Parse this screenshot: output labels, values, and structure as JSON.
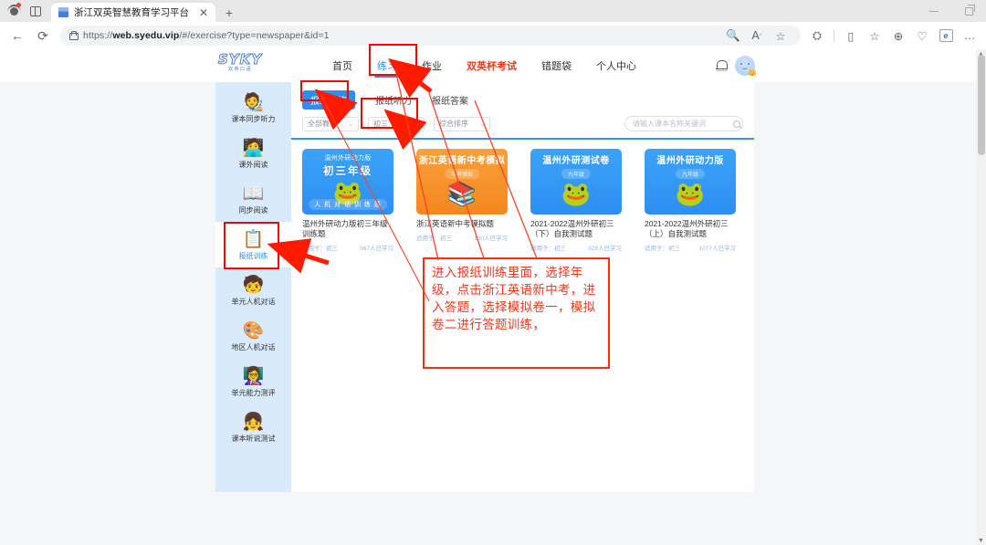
{
  "browser": {
    "tab_title": "浙江双英智慧教育学习平台",
    "tab_close": "✕",
    "new_tab": "+",
    "back": "←",
    "reload": "⟳",
    "url_prefix": "https://",
    "url_domain": "web.syedu.vip",
    "url_path": "/#/exercise?type=newspaper&id=1",
    "tool_icons": [
      "search-icon",
      "read-aloud-icon",
      "favorite-star-icon",
      "split-screen-icon",
      "collections-icon",
      "browser-essentials-icon",
      "copilot-icon",
      "settings-more-icon"
    ],
    "more": "…"
  },
  "site": {
    "logo_main": "SYKY",
    "logo_sub": "双英口语",
    "nav": [
      {
        "label": "首页",
        "state": "normal"
      },
      {
        "label": "练习",
        "state": "active"
      },
      {
        "label": "作业",
        "state": "normal"
      },
      {
        "label": "双英杯考试",
        "state": "hot"
      },
      {
        "label": "错题袋",
        "state": "normal"
      },
      {
        "label": "个人中心",
        "state": "normal"
      }
    ],
    "bell": "notification-bell-icon",
    "avatar": "user-avatar"
  },
  "sidebar": {
    "items": [
      {
        "label": "课本同步听力",
        "emoji": "🧑‍🎨",
        "active": false
      },
      {
        "label": "课外阅读",
        "emoji": "🧑‍💻",
        "active": false
      },
      {
        "label": "同步阅读",
        "emoji": "📖",
        "active": false
      },
      {
        "label": "报纸训练",
        "emoji": "📋",
        "active": true
      },
      {
        "label": "单元人机对话",
        "emoji": "🧒",
        "active": false
      },
      {
        "label": "地区人机对话",
        "emoji": "🎨",
        "active": false
      },
      {
        "label": "单元能力测评",
        "emoji": "👩‍🏫",
        "active": false
      },
      {
        "label": "课本听说测试",
        "emoji": "👧",
        "active": false
      }
    ]
  },
  "main": {
    "subtabs": [
      {
        "label": "报纸训练",
        "active": true
      },
      {
        "label": "报纸听力",
        "active": false
      },
      {
        "label": "报纸答案",
        "active": false
      }
    ],
    "filters": [
      {
        "value": "全部教材"
      },
      {
        "value": "初三"
      },
      {
        "value": "综合排序"
      }
    ],
    "caret": "⌄",
    "search": {
      "placeholder": "请输入课本名称关键词",
      "value": "",
      "icon": "search-icon"
    },
    "cards": [
      {
        "thumb_style": "blue",
        "thumb_top": "温州外研动力版",
        "thumb_big": "初三年级",
        "thumb_chip": "",
        "thumb_art": "🐸",
        "thumb_ribbon": "人 机 对 话 训 练 题",
        "title": "温州外研动力版初三年级训练题",
        "meta_left": "适用于：初三",
        "meta_right": "567人已学习"
      },
      {
        "thumb_style": "orange",
        "thumb_top": "",
        "thumb_big2": "浙江英语新中考模拟",
        "thumb_chip": "中考模拟",
        "thumb_art": "📚",
        "thumb_ribbon": "",
        "title": "浙江英语新中考模拟题",
        "meta_left": "适用于：初三",
        "meta_right": "130人已学习"
      },
      {
        "thumb_style": "blue",
        "thumb_top": "",
        "thumb_big2": "温州外研测试卷",
        "thumb_chip": "九年级",
        "thumb_art": "🐸",
        "thumb_ribbon": "",
        "title": "2021-2022温州外研初三（下）自我测试题",
        "meta_left": "适用于：初三",
        "meta_right": "328人已学习"
      },
      {
        "thumb_style": "blue",
        "thumb_top": "",
        "thumb_big2": "温州外研动力版",
        "thumb_chip": "九年级",
        "thumb_art": "🐸",
        "thumb_ribbon": "",
        "title": "2021-2022温州外研初三（上）自我测试题",
        "meta_left": "适用于：初三",
        "meta_right": "1077人已学习"
      }
    ]
  },
  "annotation": {
    "text": "进入报纸训练里面，选择年级，点击浙江英语新中考，进入答题，选择模拟卷一，模拟卷二进行答题训练，",
    "color": "#fc3316",
    "highlight_boxes": [
      "nav-练习",
      "subtab-报纸训练",
      "filter-初三",
      "sidebar-报纸训练",
      "annotation-text"
    ]
  }
}
